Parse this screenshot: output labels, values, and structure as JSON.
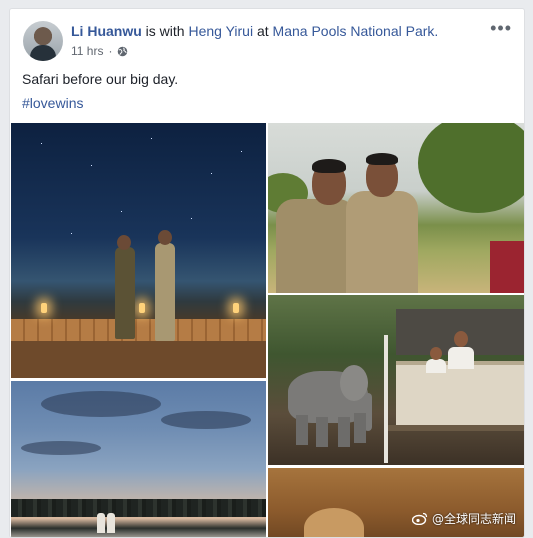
{
  "post": {
    "author": "Li Huanwu",
    "with_text": "is with",
    "tagged_person": "Heng Yirui",
    "at_text": "at",
    "location": "Mana Pools National Park.",
    "timestamp": "11 hrs",
    "privacy_icon": "globe-icon",
    "more_icon": "more-options-icon",
    "text": "Safari before our big day.",
    "hashtag": "#lovewins"
  },
  "photos": [
    {
      "name": "photo-night-deck"
    },
    {
      "name": "photo-portrait-couple"
    },
    {
      "name": "photo-elephant-camp"
    },
    {
      "name": "photo-dusk-landscape"
    },
    {
      "name": "photo-partial-animal"
    }
  ],
  "watermark": {
    "text": "@全球同志新闻",
    "icon": "weibo-icon"
  },
  "colors": {
    "link": "#365899",
    "text": "#1d2129",
    "meta": "#616770",
    "background": "#e9ebee"
  }
}
